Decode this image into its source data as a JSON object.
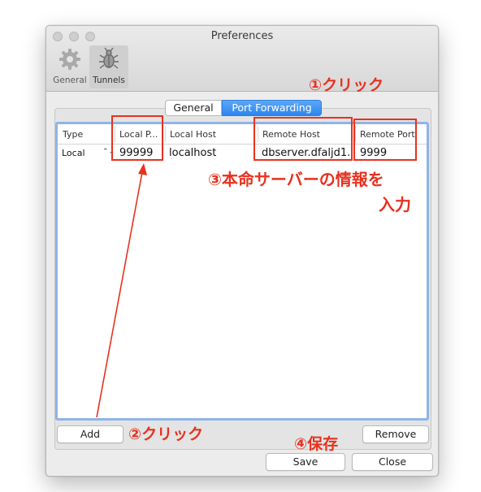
{
  "window": {
    "title": "Preferences",
    "toolbar": [
      {
        "label": "General",
        "icon": "gear-icon",
        "selected": false
      },
      {
        "label": "Tunnels",
        "icon": "tunnel-bug-icon",
        "selected": true
      }
    ]
  },
  "segmented": {
    "tabs": [
      {
        "label": "General",
        "selected": false
      },
      {
        "label": "Port Forwarding",
        "selected": true
      }
    ]
  },
  "table": {
    "headers": {
      "type": "Type",
      "local_port": "Local P...",
      "local_host": "Local Host",
      "remote_host": "Remote Host",
      "remote_port": "Remote Port"
    },
    "rows": [
      {
        "type": "Local",
        "local_port": "99999",
        "local_host": "localhost",
        "remote_host": "dbserver.dfaljd1...",
        "remote_port": "9999"
      }
    ]
  },
  "buttons": {
    "add": "Add",
    "remove": "Remove",
    "save": "Save",
    "close": "Close"
  },
  "annotations": {
    "step1": "①クリック",
    "step2": "②クリック",
    "step3_line1": "③本命サーバーの情報を",
    "step3_line2": "入力",
    "step4": "④保存",
    "color": "#e8311f"
  },
  "colors": {
    "accent": "#2c86f0",
    "table_border": "#8fb4e9"
  }
}
